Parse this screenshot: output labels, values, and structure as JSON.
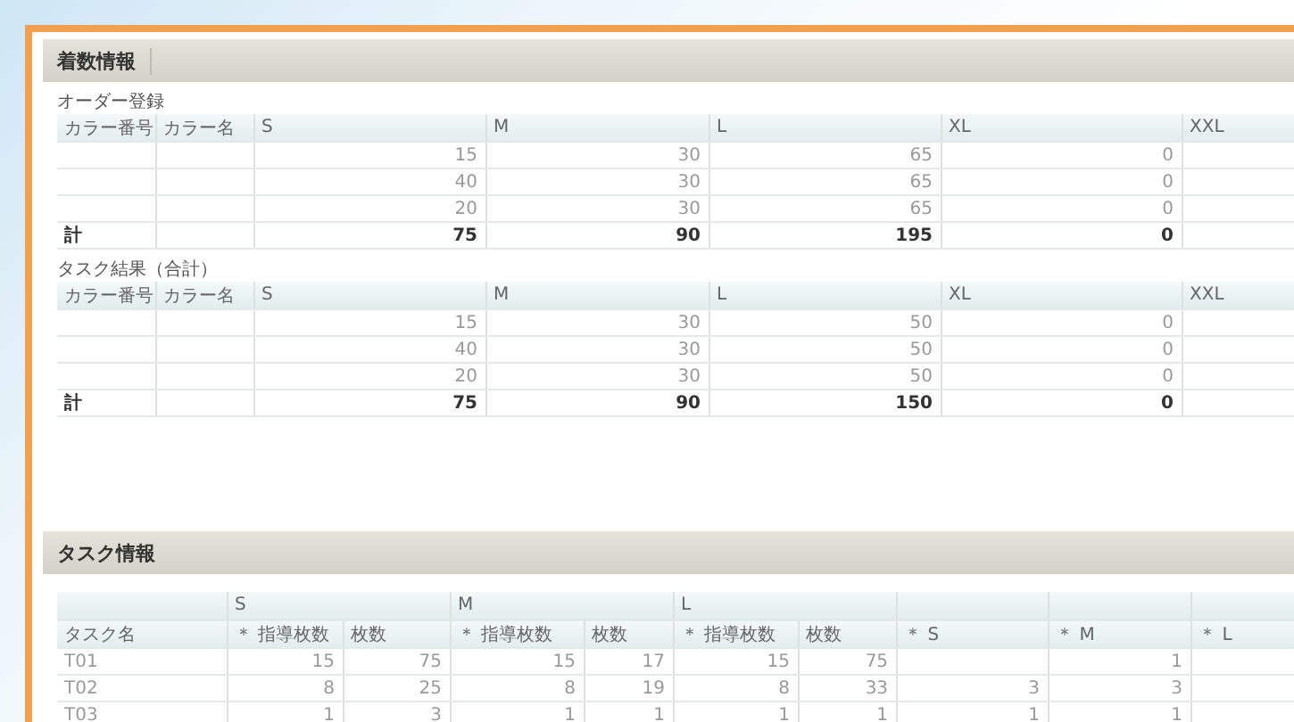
{
  "panel_title": "着数情報",
  "order_table": {
    "caption": "オーダー登録",
    "columns": [
      "カラー番号",
      "カラー名",
      "S",
      "M",
      "L",
      "XL",
      "XXL"
    ],
    "rows": [
      {
        "sizes": [
          "15",
          "30",
          "65",
          "0"
        ]
      },
      {
        "sizes": [
          "40",
          "30",
          "65",
          "0"
        ]
      },
      {
        "sizes": [
          "20",
          "30",
          "65",
          "0"
        ]
      }
    ],
    "total": {
      "label": "計",
      "sizes": [
        "75",
        "90",
        "195",
        "0"
      ]
    }
  },
  "result_table": {
    "caption": "タスク結果（合計）",
    "columns": [
      "カラー番号",
      "カラー名",
      "S",
      "M",
      "L",
      "XL",
      "XXL"
    ],
    "rows": [
      {
        "sizes": [
          "15",
          "30",
          "50",
          "0"
        ]
      },
      {
        "sizes": [
          "40",
          "30",
          "50",
          "0"
        ]
      },
      {
        "sizes": [
          "20",
          "30",
          "50",
          "0"
        ]
      }
    ],
    "total": {
      "label": "計",
      "sizes": [
        "75",
        "90",
        "150",
        "0"
      ]
    }
  },
  "task_section": {
    "title": "タスク情報",
    "groups": [
      "S",
      "M",
      "L"
    ],
    "columns": [
      "タスク名",
      "＊ 指導枚数",
      "枚数",
      "＊ 指導枚数",
      "枚数",
      "＊ 指導枚数",
      "枚数",
      "＊ S",
      "＊ M",
      "＊ L"
    ],
    "rows": [
      {
        "name": "T01",
        "s_guide": "15",
        "s_count": "75",
        "m_guide": "15",
        "m_count": "17",
        "l_guide": "15",
        "l_count": "75",
        "m": "1"
      },
      {
        "name": "T02",
        "s_guide": "8",
        "s_count": "25",
        "m_guide": "8",
        "m_count": "19",
        "l_guide": "8",
        "l_count": "33",
        "s": "3",
        "m": "3"
      },
      {
        "name": "T03",
        "s_guide": "1",
        "s_count": "3",
        "m_guide": "1",
        "m_count": "1",
        "l_guide": "1",
        "l_count": "1",
        "s": "1",
        "m": "1"
      }
    ]
  }
}
